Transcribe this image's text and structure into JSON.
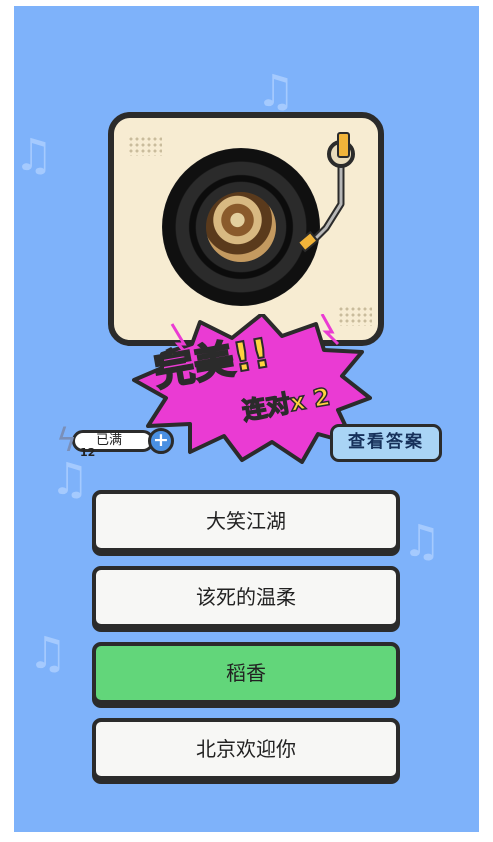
{
  "energy": {
    "label": "已满",
    "count": "12"
  },
  "result": {
    "title": "完美!!",
    "combo": "连对x 2"
  },
  "answer_button": {
    "label": "查看答案"
  },
  "options": [
    {
      "label": "大笑江湖",
      "state": "normal"
    },
    {
      "label": "该死的温柔",
      "state": "normal"
    },
    {
      "label": "稻香",
      "state": "correct"
    },
    {
      "label": "北京欢迎你",
      "state": "normal"
    }
  ],
  "colors": {
    "background": "#7eb2fa",
    "correct": "#62d67a",
    "burst": "#ea3bd3",
    "title_fill": "#ffd23f"
  },
  "icons": [
    "music-note-icon",
    "lightning-icon",
    "plus-icon",
    "vinyl-record-icon",
    "tonearm-icon"
  ]
}
